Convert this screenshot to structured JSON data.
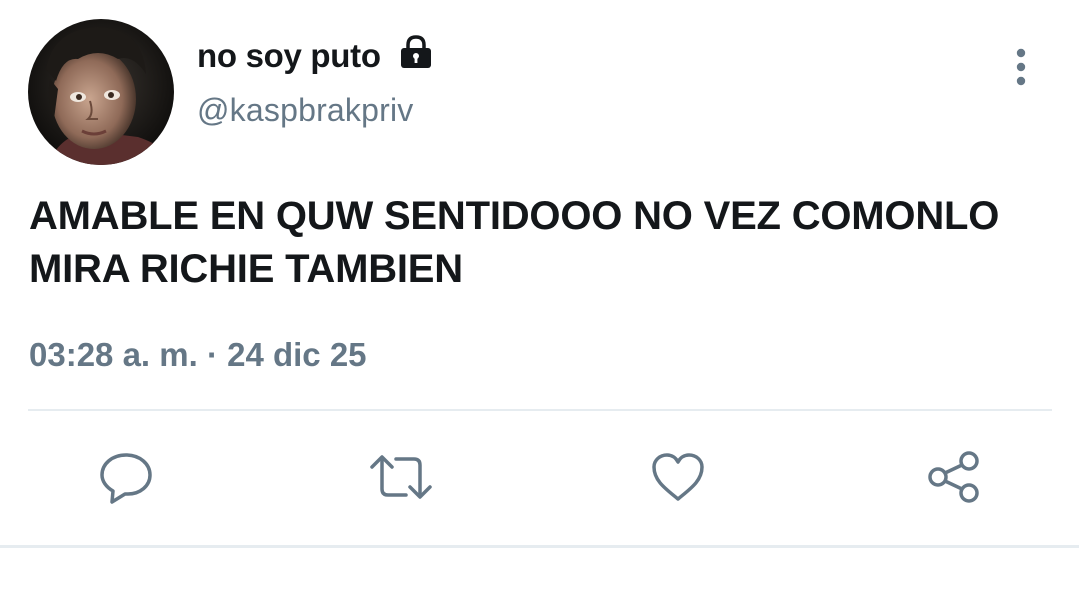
{
  "tweet": {
    "display_name": "no soy puto",
    "handle": "@kaspbrakpriv",
    "text": "AMABLE EN QUW SENTIDOOO NO VEZ COMONLO\nMIRA RICHIE TAMBIEN",
    "time": "03:28 a. m.",
    "separator": " · ",
    "date": "24 dic 25",
    "account_icon": "lock-icon"
  },
  "actions": [
    {
      "icon": "reply-icon"
    },
    {
      "icon": "retweet-icon"
    },
    {
      "icon": "like-icon"
    },
    {
      "icon": "share-icon"
    }
  ],
  "colors": {
    "text_primary": "#14171a",
    "text_secondary": "#657786",
    "divider": "#e6ecf0"
  }
}
